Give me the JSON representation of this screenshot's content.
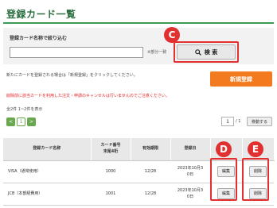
{
  "header": {
    "title": "登録カード一覧"
  },
  "filter": {
    "label": "登録カード名称で絞り込む",
    "input_value": "",
    "partial_match_label": "※部分一致",
    "search_button": "検 索"
  },
  "hint_text": "新たにカードを登録される場合は「新規登録」をクリックしてください。",
  "register_button": "新規登録",
  "warning_text": "削除前に該当カードを利用した注文・申請のキャンセルは行いませんのでご注意ください。",
  "pagination": {
    "total_text": "全2件 1~2件を表示",
    "prev": "<",
    "current": "1",
    "next": ">",
    "page_input": "1",
    "page_total": "/ 1",
    "goto_button": "移動する"
  },
  "table": {
    "headers": {
      "name": "登録カード名称",
      "card_number_line1": "カード番号",
      "card_number_line2": "末尾4桁",
      "expiry": "有効期限",
      "registered_line1": "登録日",
      "edit": "",
      "delete": ""
    },
    "rows": [
      {
        "name": "VISA（通常使用）",
        "last4": "1000",
        "expiry": "12/28",
        "registered_line1": "2023年10月3",
        "registered_line2": "0日",
        "edit": "編集",
        "delete": "削除"
      },
      {
        "name": "JCB（本部経費用）",
        "last4": "1001",
        "expiry": "12/28",
        "registered_line1": "2023年10月3",
        "registered_line2": "0日",
        "edit": "編集",
        "delete": "削除"
      }
    ]
  },
  "callouts": {
    "c": "C",
    "d": "D",
    "e": "E"
  },
  "colors": {
    "accent_green": "#3a9a52",
    "register_orange": "#f47a20",
    "warning_red": "#e02020",
    "callout_red": "#e03030"
  },
  "icons": {
    "search": "magnifier-icon"
  }
}
